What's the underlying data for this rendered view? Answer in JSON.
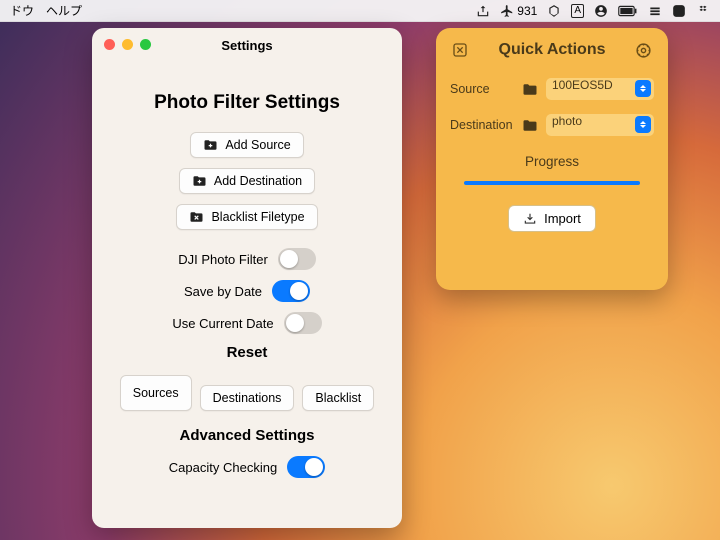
{
  "menubar": {
    "left": [
      "ドウ",
      "ヘルプ"
    ],
    "plane_count": "931"
  },
  "settings_window": {
    "titlebar": "Settings",
    "heading": "Photo Filter Settings",
    "buttons": {
      "add_source": "Add Source",
      "add_destination": "Add Destination",
      "blacklist_filetype": "Blacklist Filetype"
    },
    "toggles": {
      "dji": {
        "label": "DJI Photo Filter",
        "on": false
      },
      "save_by_date": {
        "label": "Save by Date",
        "on": true
      },
      "use_current_date": {
        "label": "Use Current Date",
        "on": false
      }
    },
    "reset": {
      "heading": "Reset",
      "sources": "Sources",
      "destinations": "Destinations",
      "blacklist": "Blacklist"
    },
    "advanced": {
      "heading": "Advanced Settings",
      "capacity_checking": {
        "label": "Capacity Checking",
        "on": true
      }
    }
  },
  "quick_actions": {
    "title": "Quick Actions",
    "source_label": "Source",
    "source_value": "100EOS5D",
    "destination_label": "Destination",
    "destination_value": "photo",
    "progress_label": "Progress",
    "import_label": "Import"
  }
}
